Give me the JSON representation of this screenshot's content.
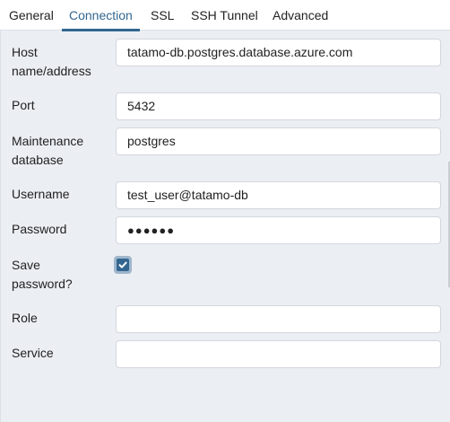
{
  "tabs": [
    {
      "label": "General",
      "active": false
    },
    {
      "label": "Connection",
      "active": true
    },
    {
      "label": "SSL",
      "active": false
    },
    {
      "label": "SSH Tunnel",
      "active": false
    },
    {
      "label": "Advanced",
      "active": false
    }
  ],
  "form": {
    "host": {
      "label_line1": "Host",
      "label_line2": "name/address",
      "value": "tatamo-db.postgres.database.azure.com"
    },
    "port": {
      "label": "Port",
      "value": "5432"
    },
    "maintenance_db": {
      "label_line1": "Maintenance",
      "label_line2": "database",
      "value": "postgres"
    },
    "username": {
      "label": "Username",
      "value": "test_user@tatamo-db"
    },
    "password": {
      "label": "Password",
      "value": "●●●●●●"
    },
    "save_password": {
      "label_line1": "Save",
      "label_line2": "password?",
      "checked": true
    },
    "role": {
      "label": "Role",
      "value": ""
    },
    "service": {
      "label": "Service",
      "value": ""
    }
  },
  "colors": {
    "accent": "#326690",
    "background": "#ebeef3",
    "input_border": "#d3d7de"
  },
  "icons": {
    "save_password_check": "check-icon"
  }
}
